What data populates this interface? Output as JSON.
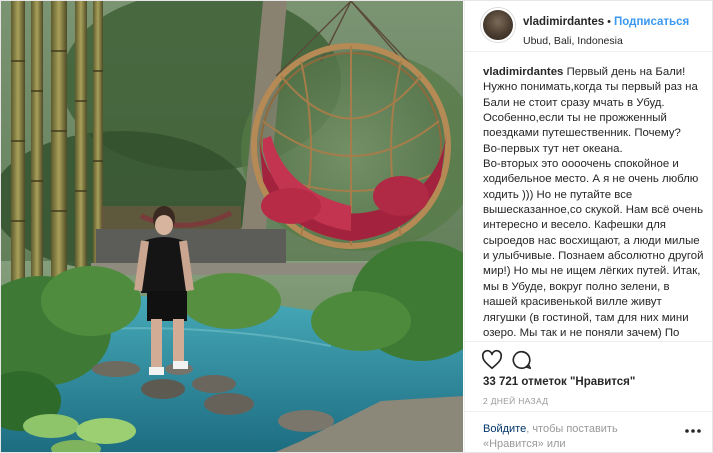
{
  "post": {
    "username": "vladimirdantes",
    "separator": "•",
    "follow_label": "Подписаться",
    "location": "Ubud, Bali, Indonesia",
    "caption_author": "vladimirdantes",
    "caption_text": " Первый день на Бали!\nНужно понимать,когда ты первый раз на Бали не стоит сразу мчать в Убуд. Особенно,если ты не прожженный поездками путешественник. Почему?\nВо-первых тут нет океана.\nВо-вторых это оооочень спокойное и ходибельное место. А я не очень люблю ходить ))) Но не путайте все вышесказанное,со скукой. Нам всё очень интересно и весело. Кафешки для сыроедов нас восхищают, а люди милые и улыбчивые. Познаем абсолютно другой мир!) Но мы не ищем лёгких путей. Итак, мы в Убуде, вокруг полно зелени, в нашей красивенькой вилле живут лягушки (в гостиной, там для них мини озеро. Мы так и не поняли зачем) По ночам они мешают спать))) Много всяких жуков,пауков, даже древесные",
    "likes": "33 721 отметок \"Нравится\"",
    "time": "2 ДНЕЙ НАЗАД",
    "login_link": "Войдите",
    "login_rest": ", чтобы поставить «Нравится» или прокомментировать.",
    "icons": {
      "like": "heart-icon",
      "comment": "comment-icon",
      "more": "more-options-icon"
    },
    "colors": {
      "link_blue": "#3897f0",
      "login_link": "#003569",
      "muted": "#999999",
      "cushion": "#a3233f",
      "pool": "#2f8fa0"
    }
  }
}
